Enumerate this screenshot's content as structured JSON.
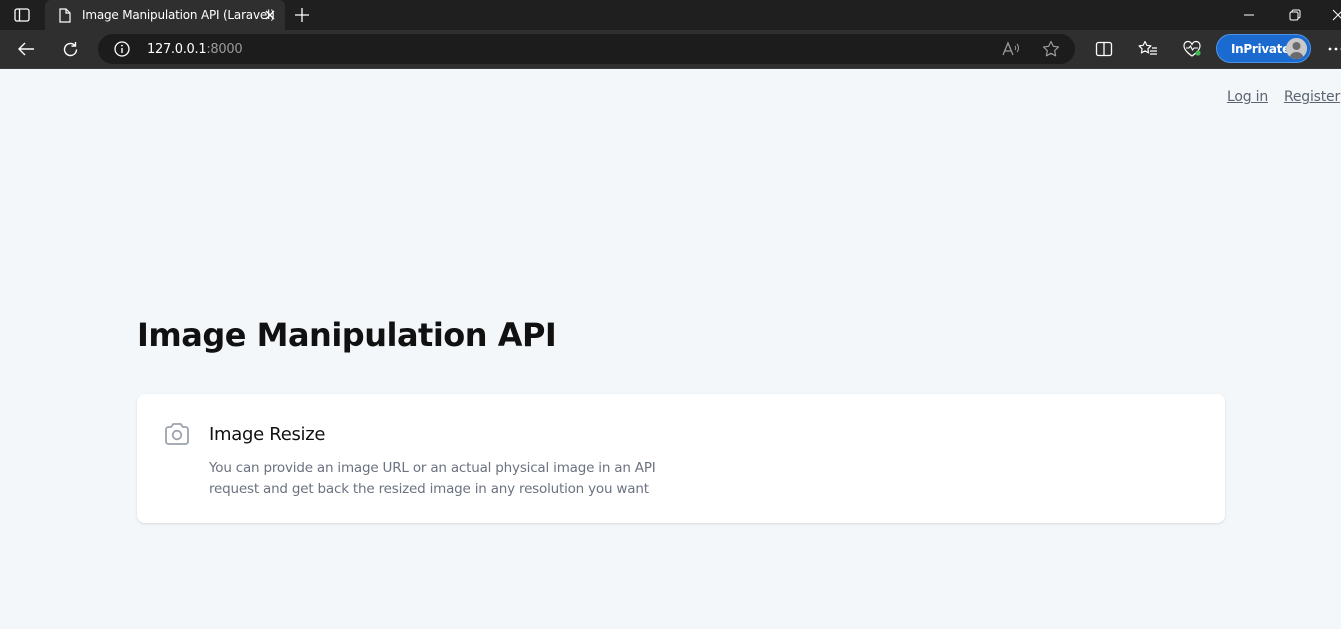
{
  "browser": {
    "tab_title": "Image Manipulation API (Laravel)",
    "url_host": "127.0.0.1",
    "url_port": ":8000",
    "inprivate_label": "InPrivate"
  },
  "header": {
    "login_label": "Log in",
    "register_label": "Register"
  },
  "main": {
    "title": "Image Manipulation API",
    "features": [
      {
        "icon": "camera-icon",
        "title": "Image Resize",
        "description": "You can provide an image URL or an actual physical image in an API request and get back the resized image in any resolution you want"
      }
    ]
  },
  "colors": {
    "page_background": "#f3f7fa",
    "card_background": "#ffffff",
    "muted_text": "#6b7280",
    "inprivate_badge": "#1a6ad0"
  }
}
